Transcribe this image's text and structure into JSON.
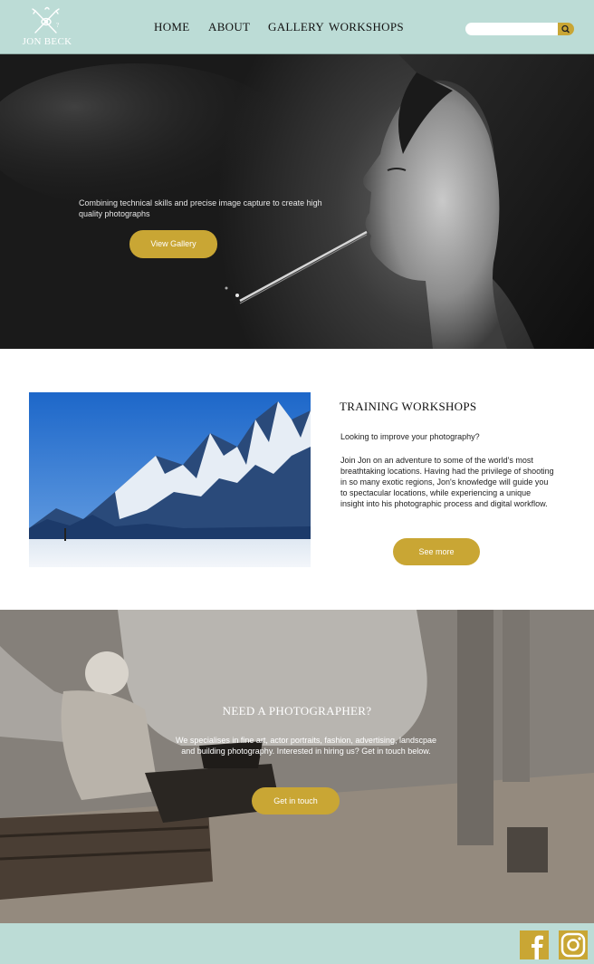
{
  "brand": {
    "name": "JON BECK"
  },
  "nav": {
    "items": [
      {
        "label": "HOME"
      },
      {
        "label": "ABOUT"
      },
      {
        "label": "GALLERY"
      },
      {
        "label": "WORKSHOPS"
      }
    ]
  },
  "search": {
    "placeholder": "",
    "value": ""
  },
  "hero": {
    "tagline": "Combining technical skills and precise image capture to create high quality photographs",
    "button_label": "View Gallery"
  },
  "workshops": {
    "title": "TRAINING WORKSHOPS",
    "lead": "Looking to improve your photography?",
    "body": "Join Jon on an adventure to some of the world's most breathtaking locations. Having had the privilege of shooting in so many exotic regions, Jon's knowledge will guide you to spectacular locations, while experiencing a unique insight into his photographic process and digital workflow.",
    "button_label": "See more"
  },
  "photographer": {
    "title": "NEED A PHOTOGRAPHER?",
    "text": "We specialises in fine art, actor portraits, fashion, advertising, landscpae and building photography. Interested in hiring us? Get in touch below.",
    "button_label": "Get in touch"
  },
  "footer": {
    "social": [
      "facebook-icon",
      "instagram-icon"
    ]
  },
  "colors": {
    "header_bg": "#bcdcd6",
    "accent_gold": "#c9a634",
    "footer_bg": "#bcdcd6"
  }
}
